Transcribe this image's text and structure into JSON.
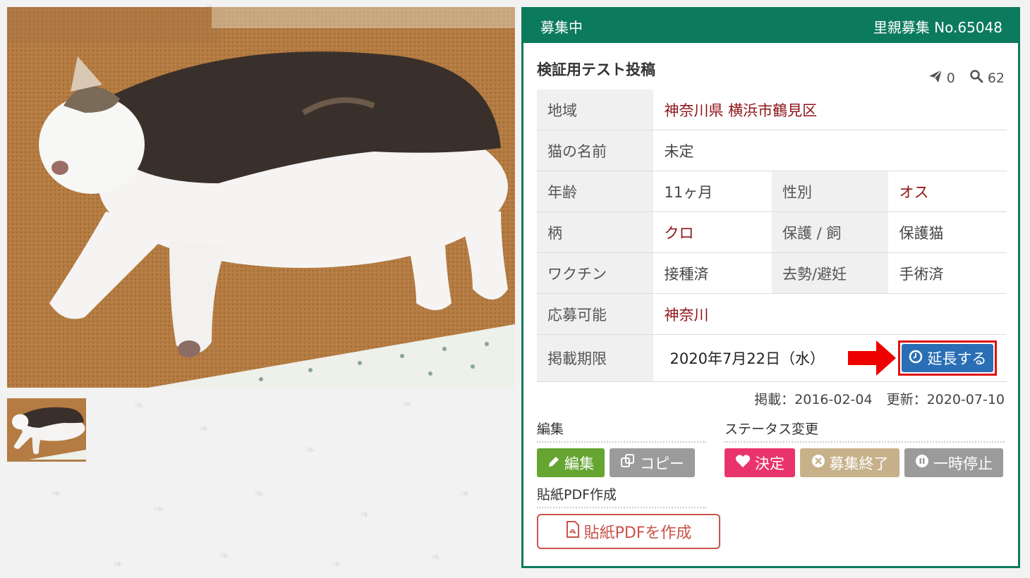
{
  "listing": {
    "status_label": "募集中",
    "listing_number": "里親募集 No.65048",
    "title": "検証用テスト投稿",
    "send_count": "0",
    "view_count": "62"
  },
  "details": {
    "region_label": "地域",
    "region_value": "神奈川県 横浜市鶴見区",
    "name_label": "猫の名前",
    "name_value": "未定",
    "age_label": "年齢",
    "age_value": "11ヶ月",
    "sex_label": "性別",
    "sex_value": "オス",
    "pattern_label": "柄",
    "pattern_value": "クロ",
    "origin_label": "保護 / 飼",
    "origin_value": "保護猫",
    "vaccine_label": "ワクチン",
    "vaccine_value": "接種済",
    "neuter_label": "去勢/避妊",
    "neuter_value": "手術済",
    "apply_label": "応募可能",
    "apply_value": "神奈川",
    "deadline_label": "掲載期限",
    "deadline_value": "2020年7月22日（水）",
    "extend_button": "延長する"
  },
  "dates": {
    "posted": "掲載：2016-02-04",
    "updated": "更新：2020-07-10"
  },
  "actions": {
    "edit_section": "編集",
    "edit_button": "編集",
    "copy_button": "コピー",
    "status_section": "ステータス変更",
    "decide_button": "決定",
    "end_button": "募集終了",
    "pause_button": "一時停止",
    "pdf_section": "貼紙PDF作成",
    "pdf_button": "貼紙PDFを作成"
  },
  "colors": {
    "accent_green": "#0c7a5d",
    "value_red": "#8e1316",
    "extend_blue": "#2a6fb5",
    "highlight_red": "#e01010"
  },
  "icons": {
    "send": "paper-plane-icon",
    "views": "search-icon",
    "extend": "clock-icon",
    "edit": "pencil-icon",
    "copy": "copy-icon",
    "decide": "heart-icon",
    "end": "times-circle-icon",
    "pause": "pause-circle-icon",
    "pdf": "pdf-file-icon"
  }
}
